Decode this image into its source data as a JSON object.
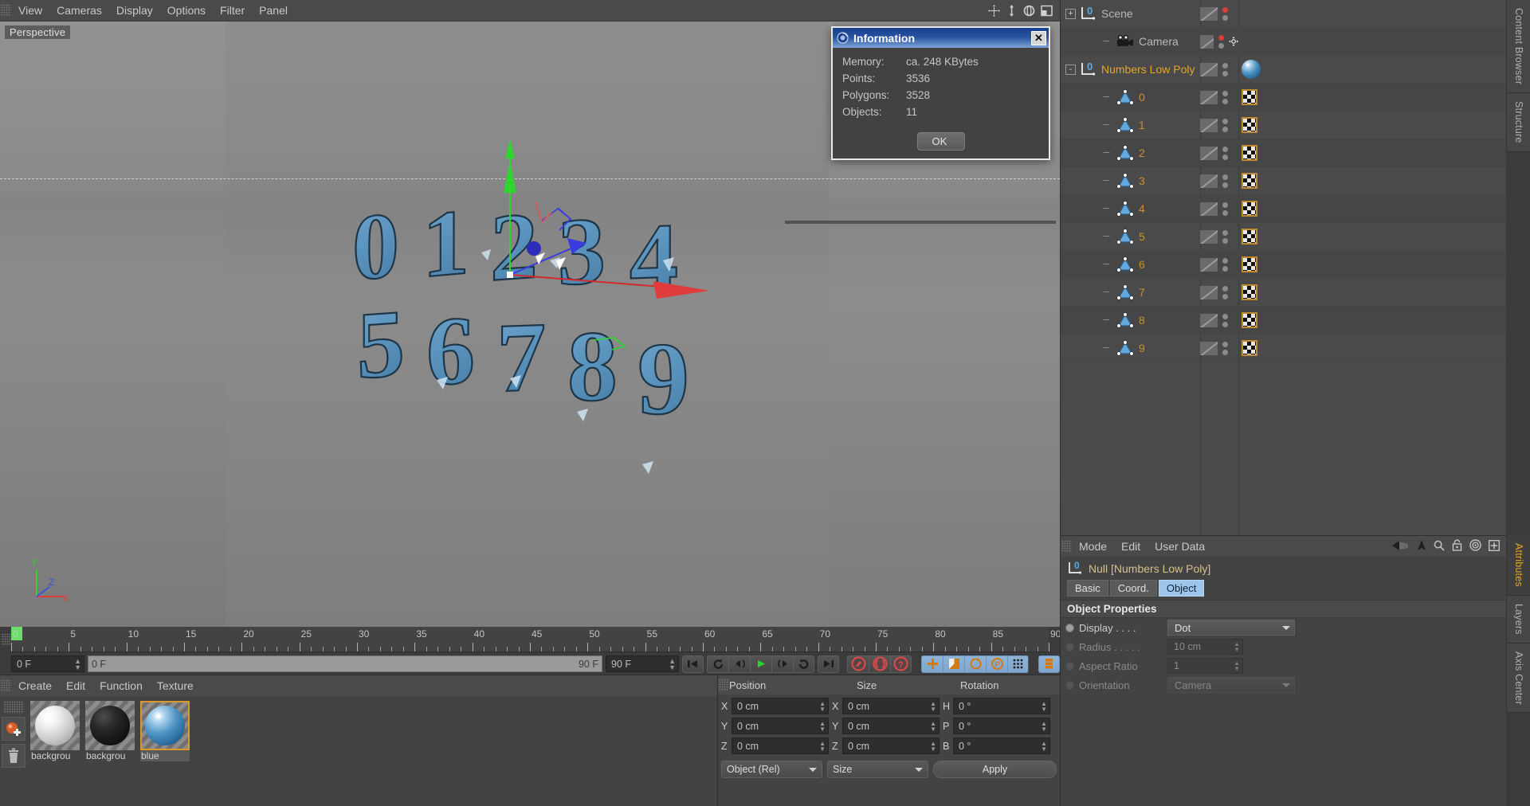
{
  "viewport": {
    "menu": [
      "View",
      "Cameras",
      "Display",
      "Options",
      "Filter",
      "Panel"
    ],
    "label": "Perspective",
    "nav_icons": [
      "pan-icon",
      "dolly-icon",
      "rotate-icon",
      "view-layout-icon"
    ],
    "axis_labels": {
      "x": "X",
      "y": "Y",
      "z": "Z"
    },
    "axis_colors": {
      "x": "#e03c3c",
      "y": "#35d135",
      "z": "#3a52e0"
    },
    "scene_numbers_top": "01234",
    "scene_numbers_bottom": "56789",
    "object_color": "#5a96bf"
  },
  "dialog": {
    "title": "Information",
    "close_label": "✕",
    "rows": [
      {
        "key": "Memory:",
        "value": "ca. 248 KBytes"
      },
      {
        "key": "Points:",
        "value": "3536"
      },
      {
        "key": "Polygons:",
        "value": "3528"
      },
      {
        "key": "Objects:",
        "value": "11"
      }
    ],
    "ok_label": "OK"
  },
  "timeline": {
    "tick_labels": [
      "0",
      "5",
      "10",
      "15",
      "20",
      "25",
      "30",
      "35",
      "40",
      "45",
      "50",
      "55",
      "60",
      "65",
      "70",
      "75",
      "80",
      "85",
      "90"
    ],
    "current_frame_top": "0 F",
    "start_frame": "0 F",
    "range_start_field": "0 F",
    "bar_left_label": "0 F",
    "bar_right_label": "90 F",
    "end_frame": "90 F",
    "transport": {
      "goto_start": "goto-start-icon",
      "rewind_loop": "rewind-icon",
      "step_back": "step-back-icon",
      "play": "play-icon",
      "step_forward": "step-forward-icon",
      "loop": "loop-icon",
      "goto_end": "goto-end-icon"
    },
    "key_buttons": [
      "record-key-icon",
      "autokey-icon",
      "key-selection-icon"
    ],
    "mode_buttons": [
      "position-key-icon",
      "scale-key-icon",
      "rotation-key-icon",
      "param-key-icon",
      "pla-key-icon"
    ],
    "extra_button": "keyframe-layout-icon"
  },
  "materials": {
    "menu": [
      "Create",
      "Edit",
      "Function",
      "Texture"
    ],
    "tools": [
      "new-material-icon",
      "delete-material-icon"
    ],
    "items": [
      {
        "name": "backgrou",
        "swatch": "white",
        "selected": false
      },
      {
        "name": "backgrou",
        "swatch": "black",
        "selected": false
      },
      {
        "name": "blue",
        "swatch": "blue",
        "selected": true
      }
    ]
  },
  "coordinates": {
    "headers": [
      "Position",
      "Size",
      "Rotation"
    ],
    "rows": [
      {
        "pos_label": "X",
        "pos_value": "0 cm",
        "size_label": "X",
        "size_value": "0 cm",
        "rot_label": "H",
        "rot_value": "0 °"
      },
      {
        "pos_label": "Y",
        "pos_value": "0 cm",
        "size_label": "Y",
        "size_value": "0 cm",
        "rot_label": "P",
        "rot_value": "0 °"
      },
      {
        "pos_label": "Z",
        "pos_value": "0 cm",
        "size_label": "Z",
        "size_value": "0 cm",
        "rot_label": "B",
        "rot_value": "0 °"
      }
    ],
    "mode_dropdown": "Object (Rel)",
    "size_dropdown": "Size",
    "apply_label": "Apply"
  },
  "object_manager": {
    "items": [
      {
        "label": "Scene",
        "icon": "null-object-icon",
        "depth": 0,
        "expander": "+",
        "selected": false,
        "number": false,
        "vis_top": "red",
        "vis_bottom": "gray",
        "tag": "none",
        "extra_icon": "axis-icon-none"
      },
      {
        "label": "Camera",
        "icon": "camera-icon",
        "depth": 1,
        "expander": "",
        "selected": false,
        "number": false,
        "vis_top": "red",
        "vis_bottom": "gray",
        "tag": "none",
        "extra_icon": "target-tag-icon"
      },
      {
        "label": "Numbers Low Poly",
        "icon": "null-object-icon",
        "depth": 0,
        "expander": "-",
        "selected": true,
        "number": false,
        "vis_top": "gray",
        "vis_bottom": "gray",
        "tag": "material-blue"
      },
      {
        "label": "0",
        "icon": "polygon-object-icon",
        "depth": 1,
        "expander": "",
        "selected": false,
        "number": true,
        "vis_top": "gray",
        "vis_bottom": "gray",
        "tag": "texture-tag"
      },
      {
        "label": "1",
        "icon": "polygon-object-icon",
        "depth": 1,
        "expander": "",
        "selected": false,
        "number": true,
        "vis_top": "gray",
        "vis_bottom": "gray",
        "tag": "texture-tag"
      },
      {
        "label": "2",
        "icon": "polygon-object-icon",
        "depth": 1,
        "expander": "",
        "selected": false,
        "number": true,
        "vis_top": "gray",
        "vis_bottom": "gray",
        "tag": "texture-tag"
      },
      {
        "label": "3",
        "icon": "polygon-object-icon",
        "depth": 1,
        "expander": "",
        "selected": false,
        "number": true,
        "vis_top": "gray",
        "vis_bottom": "gray",
        "tag": "texture-tag"
      },
      {
        "label": "4",
        "icon": "polygon-object-icon",
        "depth": 1,
        "expander": "",
        "selected": false,
        "number": true,
        "vis_top": "gray",
        "vis_bottom": "gray",
        "tag": "texture-tag"
      },
      {
        "label": "5",
        "icon": "polygon-object-icon",
        "depth": 1,
        "expander": "",
        "selected": false,
        "number": true,
        "vis_top": "gray",
        "vis_bottom": "gray",
        "tag": "texture-tag"
      },
      {
        "label": "6",
        "icon": "polygon-object-icon",
        "depth": 1,
        "expander": "",
        "selected": false,
        "number": true,
        "vis_top": "gray",
        "vis_bottom": "gray",
        "tag": "texture-tag"
      },
      {
        "label": "7",
        "icon": "polygon-object-icon",
        "depth": 1,
        "expander": "",
        "selected": false,
        "number": true,
        "vis_top": "gray",
        "vis_bottom": "gray",
        "tag": "texture-tag"
      },
      {
        "label": "8",
        "icon": "polygon-object-icon",
        "depth": 1,
        "expander": "",
        "selected": false,
        "number": true,
        "vis_top": "gray",
        "vis_bottom": "gray",
        "tag": "texture-tag"
      },
      {
        "label": "9",
        "icon": "polygon-object-icon",
        "depth": 1,
        "expander": "",
        "selected": false,
        "number": true,
        "vis_top": "gray",
        "vis_bottom": "gray",
        "tag": "texture-tag"
      }
    ]
  },
  "attributes": {
    "menu": [
      "Mode",
      "Edit",
      "User Data"
    ],
    "header_icons": [
      "back-arrow-icon",
      "up-arrow-icon",
      "search-icon",
      "lock-icon",
      "target-icon",
      "plus-icon"
    ],
    "object_title": "Null [Numbers Low Poly]",
    "tabs": [
      {
        "label": "Basic",
        "active": false
      },
      {
        "label": "Coord.",
        "active": false
      },
      {
        "label": "Object",
        "active": true
      }
    ],
    "section_title": "Object Properties",
    "properties": [
      {
        "label": "Display . . . .",
        "value": "Dot",
        "type": "dropdown",
        "enabled": true
      },
      {
        "label": "Radius . . . . .",
        "value": "10 cm",
        "type": "number",
        "enabled": false
      },
      {
        "label": "Aspect Ratio",
        "value": "1",
        "type": "number",
        "enabled": false
      },
      {
        "label": "Orientation",
        "value": "Camera",
        "type": "dropdown",
        "enabled": false
      }
    ]
  },
  "side_tabs": {
    "top": [
      {
        "label": "Content Browser",
        "active": false
      },
      {
        "label": "Structure",
        "active": false
      }
    ],
    "bottom": [
      {
        "label": "Attributes",
        "active": true
      },
      {
        "label": "Layers",
        "active": false
      },
      {
        "label": "Axis Center",
        "active": false
      }
    ]
  }
}
